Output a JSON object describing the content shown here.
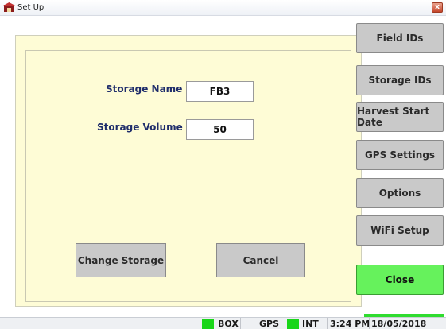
{
  "window": {
    "title": "Set Up"
  },
  "form": {
    "storage_name_label": "Storage Name",
    "storage_name_value": "FB3",
    "storage_volume_label": "Storage Volume",
    "storage_volume_value": "50",
    "change_storage_label": "Change Storage",
    "cancel_label": "Cancel"
  },
  "sidebar": {
    "buttons": [
      {
        "label": "Field IDs"
      },
      {
        "label": "Storage IDs"
      },
      {
        "label": "Harvest Start Date"
      },
      {
        "label": "GPS Settings"
      },
      {
        "label": "Options"
      },
      {
        "label": "WiFi Setup"
      },
      {
        "label": "Close"
      }
    ]
  },
  "statusbar": {
    "box_label": "BOX",
    "gps_label": "GPS",
    "int_label": "INT",
    "time": "3:24 PM",
    "date": "18/05/2018"
  },
  "colors": {
    "panel_bg": "#fefcd6",
    "label_text": "#1f2d6b",
    "close_button": "#66f25c",
    "status_indicator": "#19d619"
  }
}
